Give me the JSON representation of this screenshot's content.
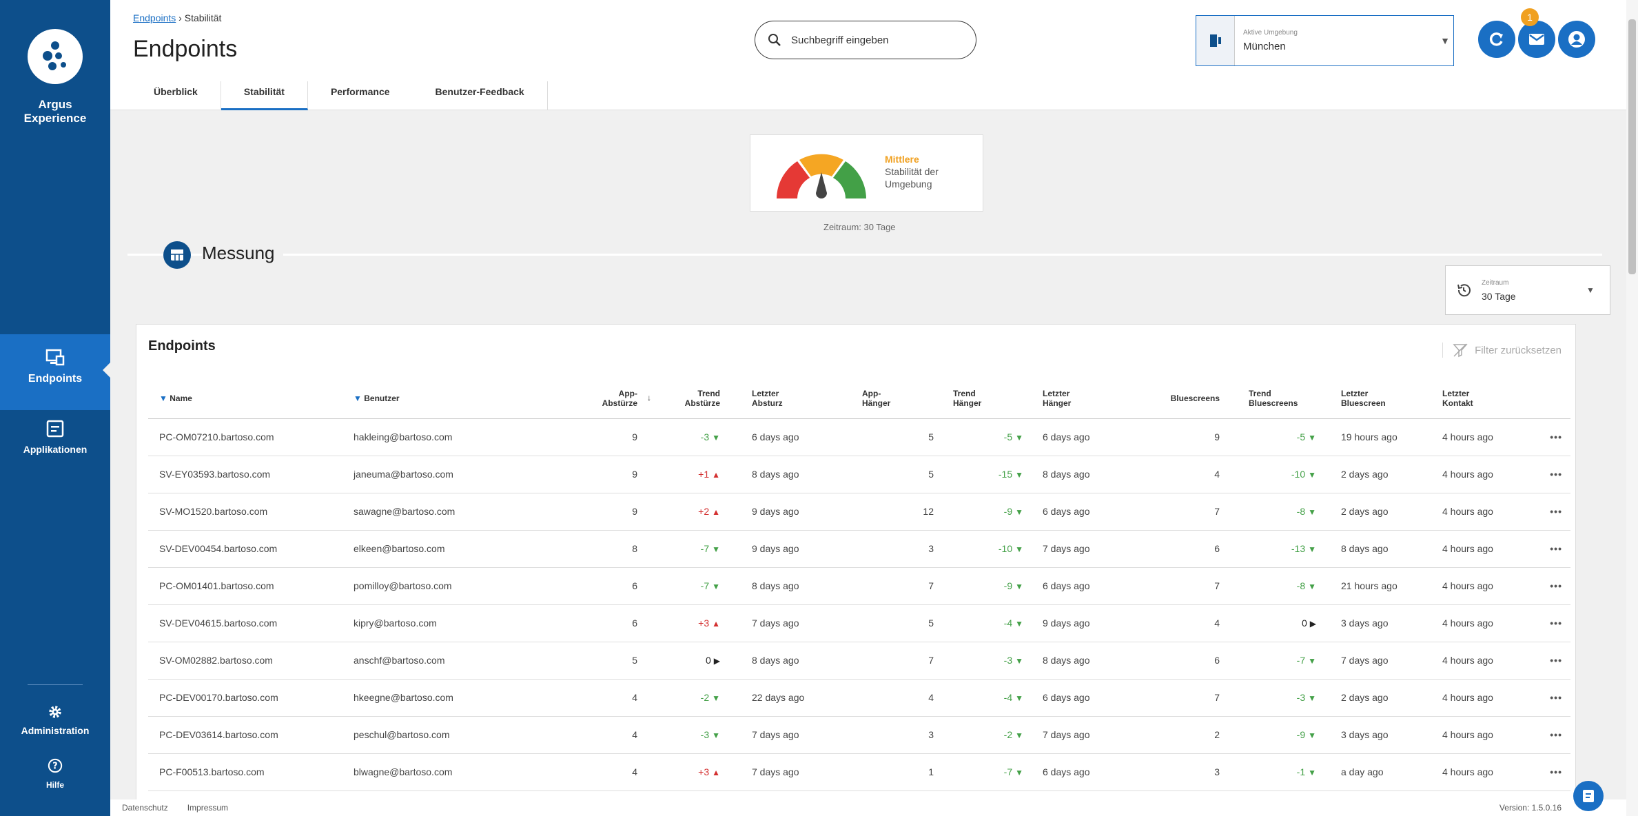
{
  "sidebar": {
    "brand_line1": "Argus",
    "brand_line2": "Experience",
    "items": [
      {
        "label": "Endpoints"
      },
      {
        "label": "Applikationen"
      },
      {
        "label": "Administration"
      },
      {
        "label": "Hilfe"
      }
    ]
  },
  "header": {
    "breadcrumb_link": "Endpoints",
    "breadcrumb_sep": " › ",
    "breadcrumb_current": "Stabilität",
    "title": "Endpoints",
    "search_placeholder": "Suchbegriff eingeben",
    "env_label": "Aktive Umgebung",
    "env_value": "München",
    "notification_count": "1",
    "icons": [
      "refresh-icon",
      "mail-icon",
      "account-icon"
    ]
  },
  "tabs": [
    {
      "label": "Überblick"
    },
    {
      "label": "Stabilität",
      "active": true
    },
    {
      "label": "Performance"
    },
    {
      "label": "Benutzer-Feedback"
    }
  ],
  "gauge": {
    "level": "Mittlere",
    "line2": "Stabilität der",
    "line3": "Umgebung",
    "level_value": 0.5,
    "colors": {
      "low": "#e53935",
      "mid": "#f5a623",
      "high": "#43a047"
    },
    "zeitraum": "Zeitraum: 30 Tage"
  },
  "messung": {
    "title": "Messung",
    "zeit_label": "Zeitraum",
    "zeit_value": "30 Tage"
  },
  "table": {
    "title": "Endpoints",
    "filter_reset": "Filter zurücksetzen",
    "headers": {
      "name": "Name",
      "user": "Benutzer",
      "app_crash_1": "App-",
      "app_crash_2": "Abstürze",
      "trend_crash_1": "Trend",
      "trend_crash_2": "Abstürze",
      "last_crash_1": "Letzter",
      "last_crash_2": "Absturz",
      "app_hang_1": "App-",
      "app_hang_2": "Hänger",
      "trend_hang_1": "Trend",
      "trend_hang_2": "Hänger",
      "last_hang_1": "Letzter",
      "last_hang_2": "Hänger",
      "bluescreens": "Bluescreens",
      "trend_blue_1": "Trend",
      "trend_blue_2": "Bluescreens",
      "last_blue_1": "Letzter",
      "last_blue_2": "Bluescreen",
      "last_contact_1": "Letzter",
      "last_contact_2": "Kontakt"
    },
    "rows": [
      {
        "name": "PC-OM07210.bartoso.com",
        "user": "hakleing@bartoso.com",
        "crashes": "9",
        "trend_crash": "-3",
        "tc_dir": "down",
        "last_crash": "6 days ago",
        "hangs": "5",
        "trend_hang": "-5",
        "th_dir": "down",
        "last_hang": "6 days ago",
        "blue": "9",
        "trend_blue": "-5",
        "tb_dir": "down",
        "last_blue": "19 hours ago",
        "contact": "4 hours ago"
      },
      {
        "name": "SV-EY03593.bartoso.com",
        "user": "janeuma@bartoso.com",
        "crashes": "9",
        "trend_crash": "+1",
        "tc_dir": "up",
        "last_crash": "8 days ago",
        "hangs": "5",
        "trend_hang": "-15",
        "th_dir": "down",
        "last_hang": "8 days ago",
        "blue": "4",
        "trend_blue": "-10",
        "tb_dir": "down",
        "last_blue": "2 days ago",
        "contact": "4 hours ago"
      },
      {
        "name": "SV-MO1520.bartoso.com",
        "user": "sawagne@bartoso.com",
        "crashes": "9",
        "trend_crash": "+2",
        "tc_dir": "up",
        "last_crash": "9 days ago",
        "hangs": "12",
        "trend_hang": "-9",
        "th_dir": "down",
        "last_hang": "6 days ago",
        "blue": "7",
        "trend_blue": "-8",
        "tb_dir": "down",
        "last_blue": "2 days ago",
        "contact": "4 hours ago"
      },
      {
        "name": "SV-DEV00454.bartoso.com",
        "user": "elkeen@bartoso.com",
        "crashes": "8",
        "trend_crash": "-7",
        "tc_dir": "down",
        "last_crash": "9 days ago",
        "hangs": "3",
        "trend_hang": "-10",
        "th_dir": "down",
        "last_hang": "7 days ago",
        "blue": "6",
        "trend_blue": "-13",
        "tb_dir": "down",
        "last_blue": "8 days ago",
        "contact": "4 hours ago"
      },
      {
        "name": "PC-OM01401.bartoso.com",
        "user": "pomilloy@bartoso.com",
        "crashes": "6",
        "trend_crash": "-7",
        "tc_dir": "down",
        "last_crash": "8 days ago",
        "hangs": "7",
        "trend_hang": "-9",
        "th_dir": "down",
        "last_hang": "6 days ago",
        "blue": "7",
        "trend_blue": "-8",
        "tb_dir": "down",
        "last_blue": "21 hours ago",
        "contact": "4 hours ago"
      },
      {
        "name": "SV-DEV04615.bartoso.com",
        "user": "kipry@bartoso.com",
        "crashes": "6",
        "trend_crash": "+3",
        "tc_dir": "up",
        "last_crash": "7 days ago",
        "hangs": "5",
        "trend_hang": "-4",
        "th_dir": "down",
        "last_hang": "9 days ago",
        "blue": "4",
        "trend_blue": "0",
        "tb_dir": "flat",
        "last_blue": "3 days ago",
        "contact": "4 hours ago"
      },
      {
        "name": "SV-OM02882.bartoso.com",
        "user": "anschf@bartoso.com",
        "crashes": "5",
        "trend_crash": "0",
        "tc_dir": "flat",
        "last_crash": "8 days ago",
        "hangs": "7",
        "trend_hang": "-3",
        "th_dir": "down",
        "last_hang": "8 days ago",
        "blue": "6",
        "trend_blue": "-7",
        "tb_dir": "down",
        "last_blue": "7 days ago",
        "contact": "4 hours ago"
      },
      {
        "name": "PC-DEV00170.bartoso.com",
        "user": "hkeegne@bartoso.com",
        "crashes": "4",
        "trend_crash": "-2",
        "tc_dir": "down",
        "last_crash": "22 days ago",
        "hangs": "4",
        "trend_hang": "-4",
        "th_dir": "down",
        "last_hang": "6 days ago",
        "blue": "7",
        "trend_blue": "-3",
        "tb_dir": "down",
        "last_blue": "2 days ago",
        "contact": "4 hours ago"
      },
      {
        "name": "PC-DEV03614.bartoso.com",
        "user": "peschul@bartoso.com",
        "crashes": "4",
        "trend_crash": "-3",
        "tc_dir": "down",
        "last_crash": "7 days ago",
        "hangs": "3",
        "trend_hang": "-2",
        "th_dir": "down",
        "last_hang": "7 days ago",
        "blue": "2",
        "trend_blue": "-9",
        "tb_dir": "down",
        "last_blue": "3 days ago",
        "contact": "4 hours ago"
      },
      {
        "name": "PC-F00513.bartoso.com",
        "user": "blwagne@bartoso.com",
        "crashes": "4",
        "trend_crash": "+3",
        "tc_dir": "up",
        "last_crash": "7 days ago",
        "hangs": "1",
        "trend_hang": "-7",
        "th_dir": "down",
        "last_hang": "6 days ago",
        "blue": "3",
        "trend_blue": "-1",
        "tb_dir": "down",
        "last_blue": "a day ago",
        "contact": "4 hours ago"
      }
    ]
  },
  "footer": {
    "privacy": "Datenschutz",
    "imprint": "Impressum",
    "version": "Version: 1.5.0.16"
  }
}
